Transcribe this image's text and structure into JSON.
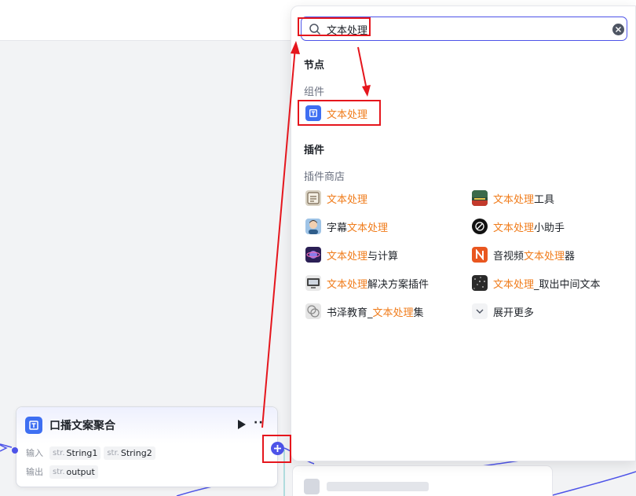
{
  "search": {
    "value": "文本处理"
  },
  "sections": {
    "nodes": "节点",
    "components": "组件",
    "plugins": "插件",
    "plugin_store": "插件商店"
  },
  "component_item": {
    "hl": "文本处理",
    "rest": ""
  },
  "plugins": [
    {
      "pre": "",
      "hl": "文本处理",
      "post": "",
      "icon": "scroll-icon"
    },
    {
      "pre": "",
      "hl": "文本处理",
      "post": "工具",
      "icon": "text-tool-icon"
    },
    {
      "pre": "字幕",
      "hl": "文本处理",
      "post": "",
      "icon": "avatar-icon"
    },
    {
      "pre": "",
      "hl": "文本处理",
      "post": "小助手",
      "icon": "openai-icon"
    },
    {
      "pre": "",
      "hl": "文本处理",
      "post": "与计算",
      "icon": "planet-icon"
    },
    {
      "pre": "音视频",
      "hl": "文本处理",
      "post": "器",
      "icon": "orange-n-icon"
    },
    {
      "pre": "",
      "hl": "文本处理",
      "post": "解决方案插件",
      "icon": "monitor-icon"
    },
    {
      "pre": "",
      "hl": "文本处理",
      "post": "_取出中间文本",
      "icon": "noise-icon"
    },
    {
      "pre": "书泽教育_",
      "hl": "文本处理",
      "post": "集",
      "icon": "shapes-icon"
    }
  ],
  "expand_more": "展开更多",
  "node": {
    "title": "口播文案聚合",
    "input_label": "输入",
    "output_label": "输出",
    "type_str": "str.",
    "type_str_short": "str.",
    "inputs": [
      "String1",
      "String2"
    ],
    "outputs": [
      "output"
    ]
  },
  "colors": {
    "accent": "#4d53e8",
    "highlight": "#f07c1b",
    "annotation": "#e5161d",
    "component_icon": "#3e6ff2"
  }
}
